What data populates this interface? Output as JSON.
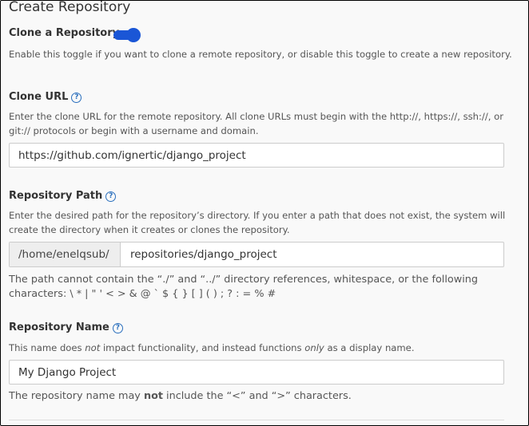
{
  "page_title": "Create Repository",
  "clone": {
    "label": "Clone a Repository",
    "toggle_on": true,
    "description": "Enable this toggle if you want to clone a remote repository, or disable this toggle to create a new repository."
  },
  "clone_url": {
    "label": "Clone URL",
    "description": "Enter the clone URL for the remote repository. All clone URLs must begin with the http://, https://, ssh://, or git:// protocols or begin with a username and domain.",
    "value": "https://github.com/ignertic/django_project"
  },
  "repo_path": {
    "label": "Repository Path",
    "description": "Enter the desired path for the repository’s directory. If you enter a path that does not exist, the system will create the directory when it creates or clones the repository.",
    "prefix": "/home/enelqsub/",
    "value": "repositories/django_project",
    "note": "The path cannot contain the “./” and “../” directory references, whitespace, or the following characters: \\ * | \" ' < > & @ ` $ { } [ ] ( ) ; ? : = % #"
  },
  "repo_name": {
    "label": "Repository Name",
    "description_pre": "This name does ",
    "description_em1": "not",
    "description_mid": " impact functionality, and instead functions ",
    "description_em2": "only",
    "description_post": " as a display name.",
    "value": "My Django Project",
    "note_pre": "The repository name may ",
    "note_bold": "not",
    "note_post": " include the “<” and “>” characters."
  },
  "icons": {
    "help": "question-circle-icon",
    "help_glyph": "?"
  },
  "colors": {
    "accent": "#1a56d6",
    "help": "#2a6fbd"
  }
}
